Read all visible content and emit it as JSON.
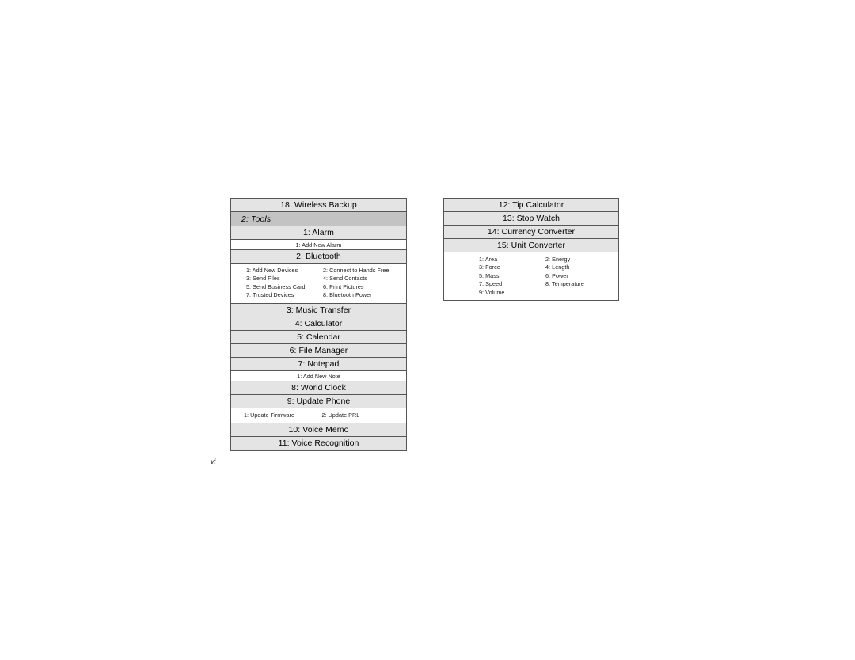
{
  "page": {
    "folio": "vi"
  },
  "left_table": {
    "rows": [
      {
        "kind": "main",
        "label": "18: Wireless Backup"
      },
      {
        "kind": "section",
        "label": "2: Tools"
      },
      {
        "kind": "main",
        "label": "1: Alarm"
      },
      {
        "kind": "sub_single",
        "label": "1: Add New Alarm"
      },
      {
        "kind": "main",
        "label": "2: Bluetooth"
      },
      {
        "kind": "sub_grid",
        "style": "offset-left",
        "items": [
          "1: Add New Devices",
          "2: Connect to Hands Free",
          "3: Send Files",
          "4: Send Contacts",
          "5: Send Business Card",
          "6: Print Pictures",
          "7: Trusted Devices",
          "8: Bluetooth Power"
        ]
      },
      {
        "kind": "main",
        "label": "3: Music Transfer"
      },
      {
        "kind": "main",
        "label": "4: Calculator"
      },
      {
        "kind": "main",
        "label": "5: Calendar"
      },
      {
        "kind": "main",
        "label": "6: File Manager"
      },
      {
        "kind": "main",
        "label": "7: Notepad"
      },
      {
        "kind": "sub_single",
        "label": "1: Add New Note"
      },
      {
        "kind": "main",
        "label": "8: World Clock"
      },
      {
        "kind": "main",
        "label": "9: Update Phone"
      },
      {
        "kind": "sub_grid",
        "style": "pair",
        "items": [
          "1: Update Firmware",
          "2: Update PRL"
        ]
      },
      {
        "kind": "main",
        "label": "10: Voice Memo"
      },
      {
        "kind": "main",
        "label": "11: Voice Recognition"
      }
    ]
  },
  "right_table": {
    "rows": [
      {
        "kind": "main",
        "label": "12: Tip Calculator"
      },
      {
        "kind": "main",
        "label": "13: Stop Watch"
      },
      {
        "kind": "main",
        "label": "14: Currency Converter"
      },
      {
        "kind": "main",
        "label": "15: Unit Converter"
      },
      {
        "kind": "sub_grid",
        "style": "offset-wide",
        "items": [
          "1: Area",
          "2: Energy",
          "3: Force",
          "4: Length",
          "5: Mass",
          "6: Power",
          "7: Speed",
          "8: Temperature",
          "9: Volume",
          ""
        ]
      }
    ]
  },
  "colors": {
    "row_main_bg": "#e4e4e4",
    "row_section_bg": "#c3c3c3",
    "row_sub_bg": "#ffffff",
    "border": "#555555",
    "text": "#000000"
  }
}
